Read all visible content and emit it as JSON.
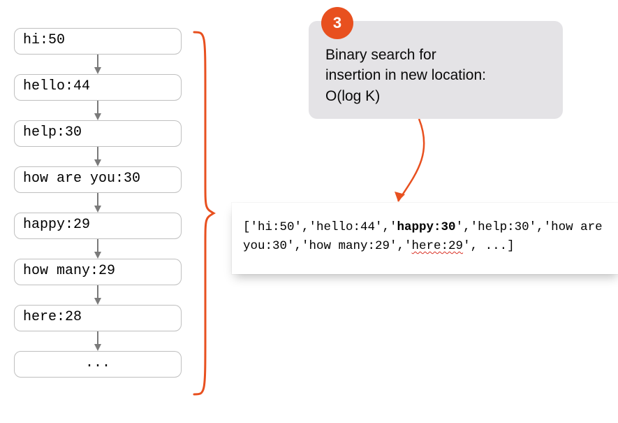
{
  "step": {
    "number": "3"
  },
  "callout": {
    "line1": "Binary search for",
    "line2": "insertion in new location:",
    "line3": "O(log K)"
  },
  "list": {
    "items": [
      "hi:50",
      "hello:44",
      "help:30",
      "how are you:30",
      "happy:29",
      "how many:29",
      "here:28",
      "..."
    ]
  },
  "output": {
    "seg1": "['hi:50','hello:44','",
    "bold": "happy:30",
    "seg2": "','help:30','how are you:30','how many:29','",
    "squiggle": "here:29",
    "seg3": "', ...]"
  },
  "colors": {
    "accent": "#E8501F",
    "border": "#BFBFBF",
    "calloutBg": "#E4E3E6"
  },
  "chart_data": {
    "type": "table",
    "title": "Binary search for insertion in new location: O(log K)",
    "linked_list": [
      {
        "key": "hi",
        "value": 50
      },
      {
        "key": "hello",
        "value": 44
      },
      {
        "key": "help",
        "value": 30
      },
      {
        "key": "how are you",
        "value": 30
      },
      {
        "key": "happy",
        "value": 29
      },
      {
        "key": "how many",
        "value": 29
      },
      {
        "key": "here",
        "value": 28
      }
    ],
    "result_array": [
      "hi:50",
      "hello:44",
      "happy:30",
      "help:30",
      "how are you:30",
      "how many:29",
      "here:29"
    ],
    "highlighted_insertion": "happy:30",
    "complexity": "O(log K)"
  }
}
